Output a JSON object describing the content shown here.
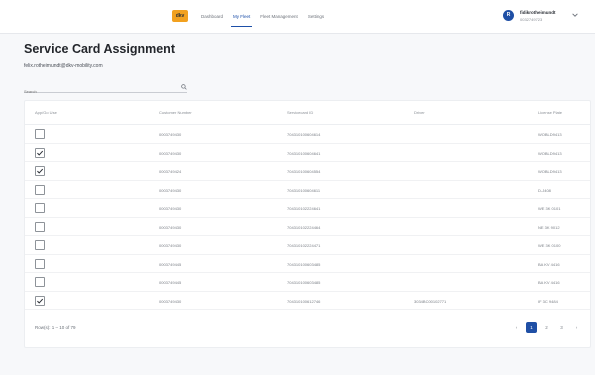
{
  "nav": {
    "logo_text": "dkv",
    "items": [
      {
        "label": "Dashboard",
        "active": false
      },
      {
        "label": "My Fleet",
        "active": true
      },
      {
        "label": "Fleet Management",
        "active": false
      },
      {
        "label": "Settings",
        "active": false
      }
    ]
  },
  "user": {
    "initial": "R",
    "name": "fidikrotheimundt",
    "sub": "0032749723"
  },
  "page": {
    "title": "Service Card Assignment",
    "email": "felix.rotheimundt@dkv-mobility.com"
  },
  "search": {
    "placeholder": "Search"
  },
  "table": {
    "headers": [
      "App/Go Use",
      "Customer Number",
      "Servicecard ID",
      "Driver",
      "License Plate"
    ],
    "rows": [
      {
        "checked": false,
        "customer": "0003749430",
        "card": "704310100604614",
        "driver": "",
        "plate": "WOBLD9413"
      },
      {
        "checked": true,
        "customer": "0003749430",
        "card": "704310100604641",
        "driver": "",
        "plate": "WOBLD9413"
      },
      {
        "checked": true,
        "customer": "0003749424",
        "card": "704310100604554",
        "driver": "",
        "plate": "WOBLD9413"
      },
      {
        "checked": false,
        "customer": "0003749430",
        "card": "704310100604611",
        "driver": "",
        "plate": "D-J408"
      },
      {
        "checked": false,
        "customer": "0003749430",
        "card": "704310102224641",
        "driver": "",
        "plate": "WE 3K 0101"
      },
      {
        "checked": false,
        "customer": "0003749430",
        "card": "704310102224464",
        "driver": "",
        "plate": "NE 3K 9012"
      },
      {
        "checked": false,
        "customer": "0003749430",
        "card": "704310102224471",
        "driver": "",
        "plate": "WE 3K 0100"
      },
      {
        "checked": false,
        "customer": "0003749445",
        "card": "704310100603485",
        "driver": "",
        "plate": "BA KV 4416"
      },
      {
        "checked": false,
        "customer": "0003749445",
        "card": "704310100603485",
        "driver": "",
        "plate": "BA KV 4416"
      },
      {
        "checked": true,
        "customer": "0003749430",
        "card": "704310100612746",
        "driver": "3034BC00102771",
        "plate": "IF 3C 9484"
      }
    ],
    "footer": {
      "rows_text": "Row(s): 1 – 10 of 79"
    }
  },
  "pager": {
    "prev": "‹",
    "pages": [
      "1",
      "2",
      "3"
    ],
    "active_page": "1",
    "next": "›"
  },
  "colors": {
    "accent": "#1f4fa5",
    "logo": "#f2a11f"
  }
}
